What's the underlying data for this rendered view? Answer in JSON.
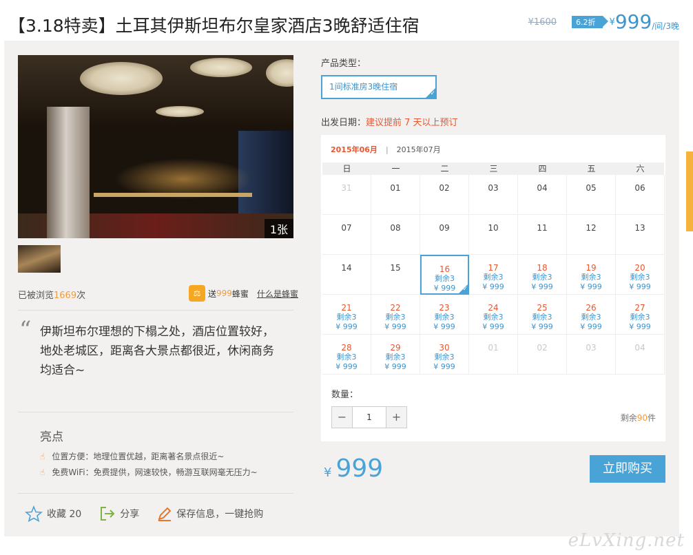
{
  "header": {
    "title": "【3.18特卖】土耳其伊斯坦布尔皇家酒店3晚舒适住宿",
    "original_price": "¥1600",
    "discount": "6.2折",
    "currency": "¥",
    "price": "999",
    "unit": "/间/3晚"
  },
  "gallery": {
    "photo_count": "1张"
  },
  "stats": {
    "views_prefix": "已被浏览",
    "views_count": "1669",
    "views_suffix": "次",
    "honey_prefix": "送",
    "honey_amount": "999",
    "honey_suffix": "蜂蜜",
    "honey_link": "什么是蜂蜜"
  },
  "quote": "伊斯坦布尔理想的下榻之处，酒店位置较好，地处老城区，距离各大景点都很近，休闲商务均适合~",
  "highlights": {
    "title": "亮点",
    "items": [
      "位置方便：地理位置优越，距离著名景点很近~",
      "免费WiFi：免费提供，网速较快，畅游互联网毫无压力~"
    ]
  },
  "actions": {
    "favorite": "收藏 20",
    "share": "分享",
    "save": "保存信息，一键抢购"
  },
  "product": {
    "type_label": "产品类型：",
    "type_option": "1间标准房3晚住宿"
  },
  "departure": {
    "label": "出发日期：",
    "note": "建议提前 7 天以上预订"
  },
  "calendar": {
    "months": [
      "2015年06月",
      "2015年07月"
    ],
    "weekdays": [
      "日",
      "一",
      "二",
      "三",
      "四",
      "五",
      "六"
    ],
    "days": [
      {
        "d": "31",
        "muted": true
      },
      {
        "d": "01"
      },
      {
        "d": "02"
      },
      {
        "d": "03"
      },
      {
        "d": "04"
      },
      {
        "d": "05"
      },
      {
        "d": "06"
      },
      {
        "d": "07"
      },
      {
        "d": "08"
      },
      {
        "d": "09"
      },
      {
        "d": "10"
      },
      {
        "d": "11"
      },
      {
        "d": "12"
      },
      {
        "d": "13"
      },
      {
        "d": "14"
      },
      {
        "d": "15"
      },
      {
        "d": "16",
        "remain": "剩余3",
        "price": "¥ 999",
        "selected": true
      },
      {
        "d": "17",
        "remain": "剩余3",
        "price": "¥ 999"
      },
      {
        "d": "18",
        "remain": "剩余3",
        "price": "¥ 999"
      },
      {
        "d": "19",
        "remain": "剩余3",
        "price": "¥ 999"
      },
      {
        "d": "20",
        "remain": "剩余3",
        "price": "¥ 999"
      },
      {
        "d": "21",
        "remain": "剩余3",
        "price": "¥ 999"
      },
      {
        "d": "22",
        "remain": "剩余3",
        "price": "¥ 999"
      },
      {
        "d": "23",
        "remain": "剩余3",
        "price": "¥ 999"
      },
      {
        "d": "24",
        "remain": "剩余3",
        "price": "¥ 999"
      },
      {
        "d": "25",
        "remain": "剩余3",
        "price": "¥ 999"
      },
      {
        "d": "26",
        "remain": "剩余3",
        "price": "¥ 999"
      },
      {
        "d": "27",
        "remain": "剩余3",
        "price": "¥ 999"
      },
      {
        "d": "28",
        "remain": "剩余3",
        "price": "¥ 999"
      },
      {
        "d": "29",
        "remain": "剩余3",
        "price": "¥ 999"
      },
      {
        "d": "30",
        "remain": "剩余3",
        "price": "¥ 999"
      },
      {
        "d": "01",
        "muted": true
      },
      {
        "d": "02",
        "muted": true
      },
      {
        "d": "03",
        "muted": true
      },
      {
        "d": "04",
        "muted": true
      }
    ]
  },
  "quantity": {
    "label": "数量：",
    "value": "1",
    "stock_prefix": "剩余",
    "stock_count": "90",
    "stock_suffix": "件"
  },
  "total": {
    "currency": "¥",
    "price": "999"
  },
  "buy_button": "立即购买",
  "watermark": "eLvXing.net",
  "colors": {
    "accent": "#4aa3d6",
    "warn": "#e8562f",
    "honey": "#f19b3c"
  }
}
